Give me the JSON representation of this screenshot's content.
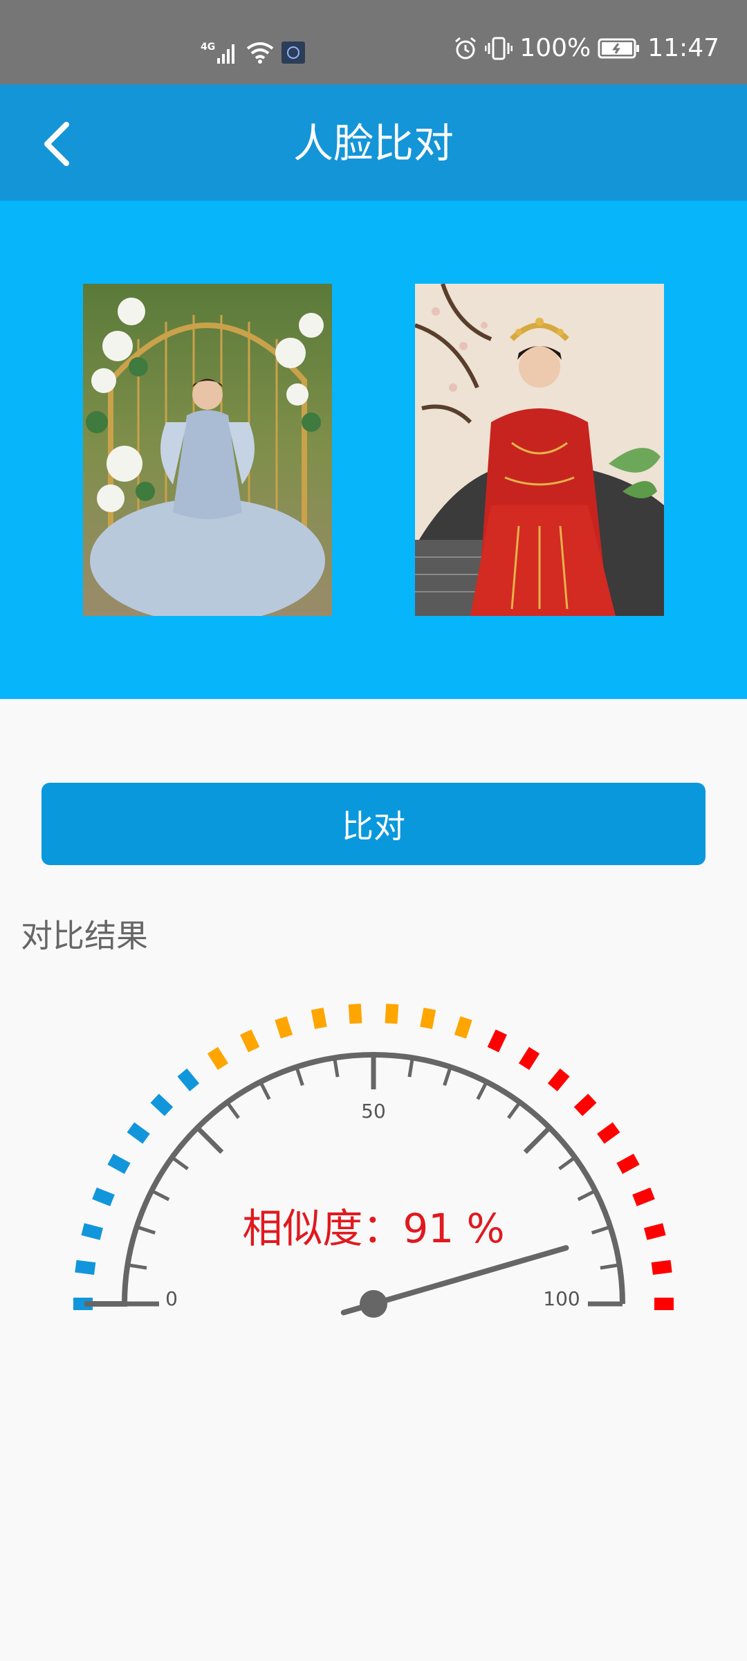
{
  "status_bar": {
    "network": "4G",
    "battery": "100%",
    "time": "11:47"
  },
  "app_bar": {
    "title": "人脸比对",
    "back_icon": "chevron-left-icon"
  },
  "photos": [
    {
      "name": "photo-1",
      "description_icon": "photo"
    },
    {
      "name": "photo-2",
      "description_icon": "photo"
    }
  ],
  "compare_button": {
    "label": "比对"
  },
  "result": {
    "label": "对比结果",
    "similarity_text": "相似度：91 %",
    "similarity_value": 91
  },
  "gauge": {
    "min": 0,
    "max": 100,
    "tick_labels": [
      "0",
      "50",
      "100"
    ],
    "colors": {
      "low": "#1296db",
      "mid": "#ffa500",
      "high": "#ff0000",
      "dial": "#666666",
      "value_text": "#e0191f"
    }
  }
}
